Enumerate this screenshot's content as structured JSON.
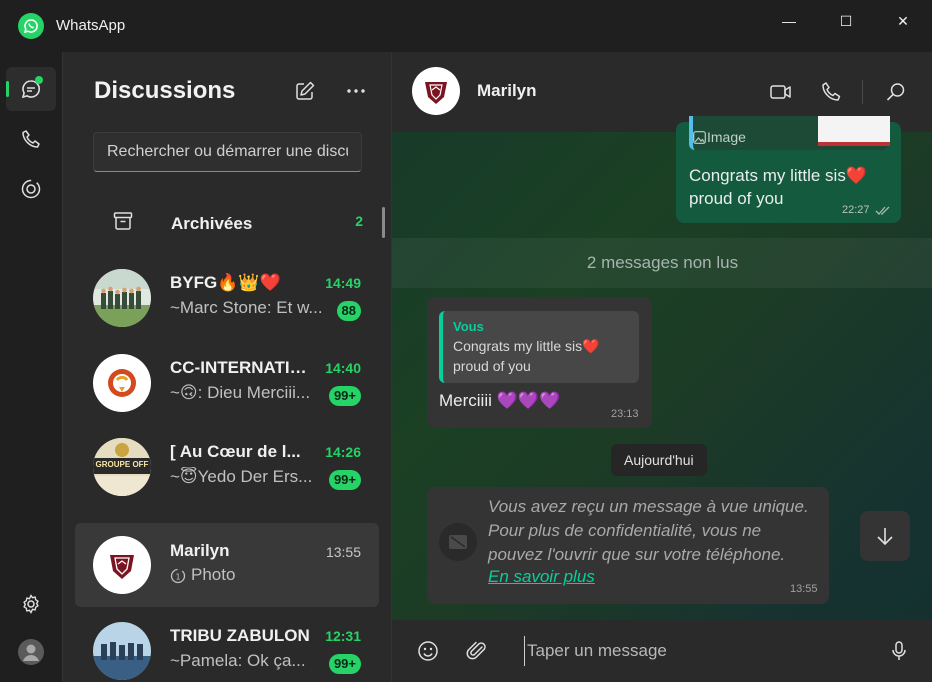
{
  "app": {
    "title": "WhatsApp"
  },
  "window_controls": {
    "minimize": "—",
    "maximize": "☐",
    "close": "✕"
  },
  "chat_list": {
    "title": "Discussions",
    "search_placeholder": "Rechercher ou démarrer une discussion",
    "archived": {
      "label": "Archivées",
      "count": "2"
    },
    "chats": [
      {
        "name": "BYFG🔥👑❤️",
        "time": "14:49",
        "preview": "~Marc Stone: Et w...",
        "badge": "88",
        "unread": true
      },
      {
        "name": "CC-INTERNATIONAL",
        "time": "14:40",
        "preview": "~🙃: Dieu Merciii...",
        "badge": "99+",
        "unread": true
      },
      {
        "name": "[ Au Cœur de l...",
        "time": "14:26",
        "preview": "~😇Yedo Der Ers...",
        "badge": "99+",
        "unread": true
      },
      {
        "name": "Marilyn",
        "time": "13:55",
        "preview": "Photo",
        "badge": "",
        "unread": false
      },
      {
        "name": "TRIBU ZABULON",
        "time": "12:31",
        "preview": "~Pamela: Ok ça...",
        "badge": "99+",
        "unread": true
      }
    ],
    "avatar_text": {
      "groupe_off": "GROUPE OFF"
    }
  },
  "conversation": {
    "contact_name": "Marilyn",
    "messages": {
      "outgoing": {
        "quote_label": "Image",
        "text": "Congrats my little sis❤️ proud of you",
        "time": "22:27"
      },
      "unread_divider": "2 messages non lus",
      "incoming_reply": {
        "quote_author": "Vous",
        "quote_text": "Congrats my little sis❤️ proud of you",
        "text": "Merciiii 💜💜💜",
        "time": "23:13"
      },
      "date_chip": "Aujourd'hui",
      "view_once": {
        "text": "Vous avez reçu un message à vue unique. Pour plus de confidentialité, vous ne pouvez l'ouvrir que sur votre téléphone.",
        "link": "En savoir plus",
        "time": "13:55"
      }
    },
    "composer_placeholder": "Taper un message"
  },
  "colors": {
    "accent": "#25d366",
    "bubble_out": "#135a3e",
    "bubble_in": "#343434",
    "quote_accent": "#06cf9c"
  }
}
